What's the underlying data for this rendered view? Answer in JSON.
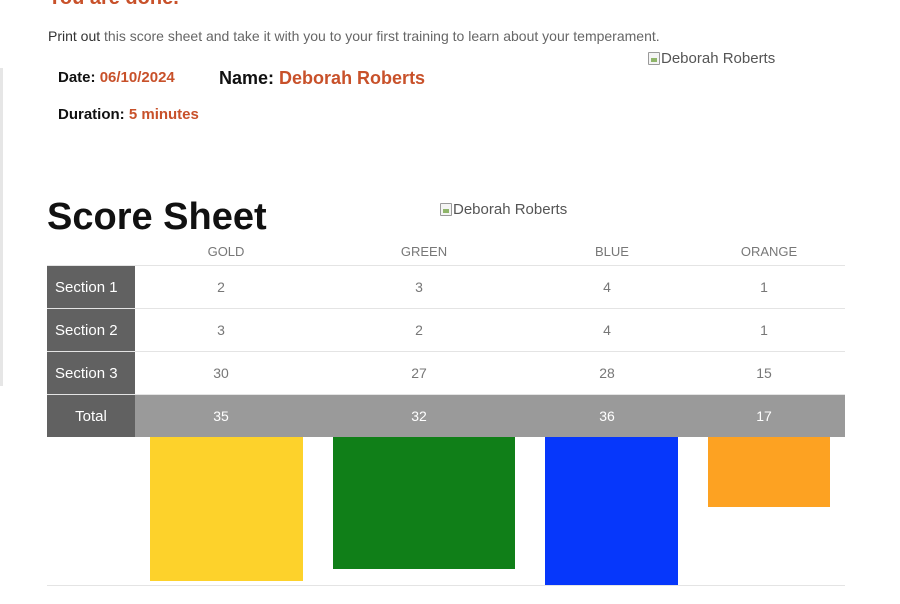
{
  "heading": {
    "done_text": "You are done."
  },
  "intro": {
    "strong": "Print out",
    "rest": " this score sheet and take it with you to your first training to learn about your temperament."
  },
  "meta": {
    "date_label": "Date:",
    "date_value": "06/10/2024",
    "name_label": "Name:",
    "name_value": "Deborah Roberts",
    "duration_label": "Duration:",
    "duration_value": "5 minutes"
  },
  "images": {
    "top_alt": "Deborah Roberts",
    "mid_alt": "Deborah Roberts"
  },
  "score_sheet": {
    "title": "Score Sheet",
    "columns": [
      "GOLD",
      "GREEN",
      "BLUE",
      "ORANGE"
    ],
    "rows": [
      {
        "label": "Section 1",
        "values": [
          2,
          3,
          4,
          1
        ]
      },
      {
        "label": "Section 2",
        "values": [
          3,
          2,
          4,
          1
        ]
      },
      {
        "label": "Section 3",
        "values": [
          30,
          27,
          28,
          15
        ]
      }
    ],
    "total": {
      "label": "Total",
      "values": [
        35,
        32,
        36,
        17
      ]
    }
  },
  "chart_data": {
    "type": "bar",
    "categories": [
      "GOLD",
      "GREEN",
      "BLUE",
      "ORANGE"
    ],
    "values": [
      35,
      32,
      36,
      17
    ],
    "colors": [
      "#fdd22b",
      "#107f18",
      "#0637fb",
      "#fda222"
    ]
  }
}
